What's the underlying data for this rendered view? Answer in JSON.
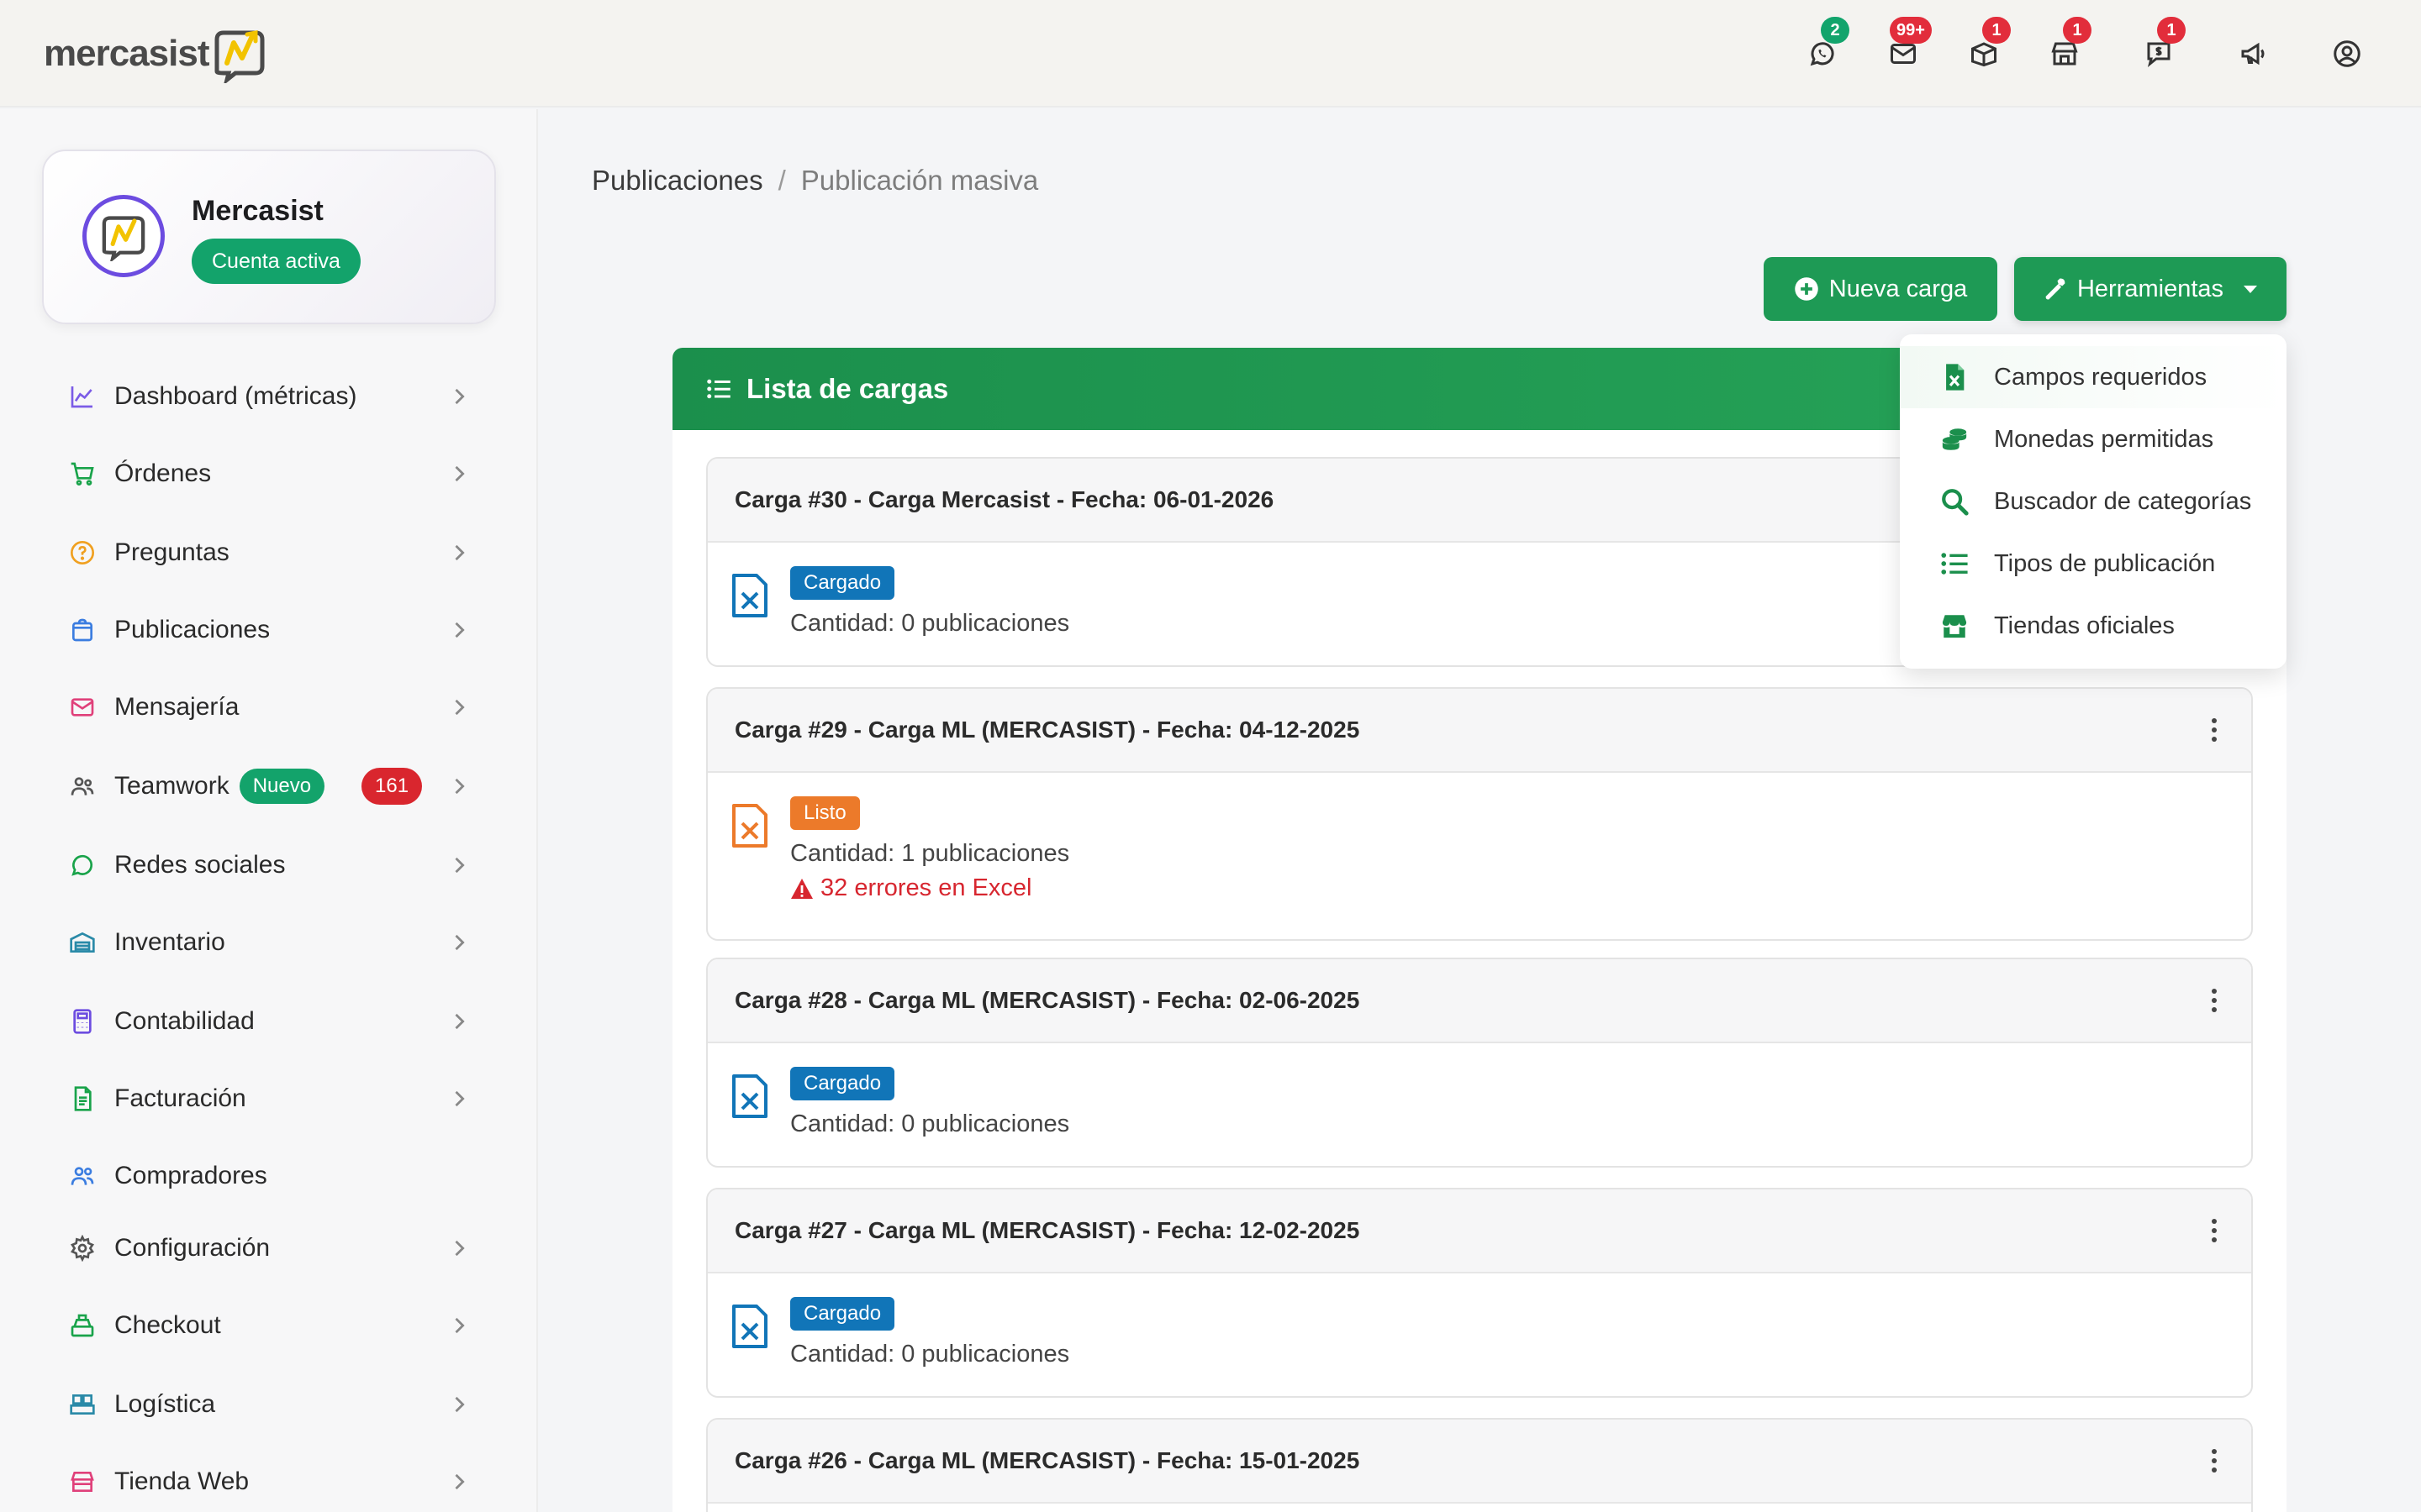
{
  "app": {
    "logo_text": "mercasist"
  },
  "top_icons": [
    {
      "icon": "whatsapp-icon",
      "badge": "2",
      "badge_color": "#12a46c"
    },
    {
      "icon": "mail-icon",
      "badge": "99+",
      "badge_color": "#e22d3b"
    },
    {
      "icon": "box-icon",
      "badge": "1",
      "badge_color": "#e22d3b"
    },
    {
      "icon": "store-icon",
      "badge": "1",
      "badge_color": "#e22d3b"
    },
    {
      "icon": "dollar-chat-icon",
      "badge": "1",
      "badge_color": "#e22d3b"
    },
    {
      "icon": "megaphone-icon",
      "badge": "",
      "badge_color": ""
    },
    {
      "icon": "user-circle-icon",
      "badge": "",
      "badge_color": ""
    }
  ],
  "account": {
    "name": "Mercasist",
    "status": "Cuenta activa"
  },
  "sidebar": {
    "items": [
      {
        "label": "Dashboard (métricas)",
        "icon": "chart-line-icon"
      },
      {
        "label": "Órdenes",
        "icon": "cart-icon"
      },
      {
        "label": "Preguntas",
        "icon": "question-icon"
      },
      {
        "label": "Publicaciones",
        "icon": "bag-icon"
      },
      {
        "label": "Mensajería",
        "icon": "envelope-icon"
      },
      {
        "label": "Teamwork",
        "icon": "users-icon",
        "new_badge": "Nuevo",
        "count": "161"
      },
      {
        "label": "Redes sociales",
        "icon": "whatsapp-icon"
      },
      {
        "label": "Inventario",
        "icon": "warehouse-icon"
      },
      {
        "label": "Contabilidad",
        "icon": "calculator-icon"
      },
      {
        "label": "Facturación",
        "icon": "invoice-icon"
      },
      {
        "label": "Compradores",
        "icon": "buyers-icon"
      },
      {
        "label": "Configuración",
        "icon": "gear-icon"
      },
      {
        "label": "Checkout",
        "icon": "register-icon"
      },
      {
        "label": "Logística",
        "icon": "truck-icon"
      },
      {
        "label": "Tienda Web",
        "icon": "storefront-icon"
      }
    ]
  },
  "breadcrumb": {
    "parent": "Publicaciones",
    "separator": "/",
    "current": "Publicación masiva"
  },
  "toolbar": {
    "new_label": "Nueva carga",
    "tools_label": "Herramientas"
  },
  "tools_menu": {
    "items": [
      {
        "label": "Campos requeridos",
        "icon": "excel-file-icon"
      },
      {
        "label": "Monedas permitidas",
        "icon": "coins-icon"
      },
      {
        "label": "Buscador de categorías",
        "icon": "search-icon"
      },
      {
        "label": "Tipos de publicación",
        "icon": "list-icon"
      },
      {
        "label": "Tiendas oficiales",
        "icon": "store-icon"
      }
    ]
  },
  "list": {
    "title": "Lista de cargas",
    "cards": [
      {
        "title": "Carga #30 - Carga Mercasist - Fecha: 06-01-2026",
        "status": "Cargado",
        "status_color": "#1175b8",
        "quantity": "Cantidad: 0 publicaciones",
        "error": ""
      },
      {
        "title": "Carga #29 - Carga ML (MERCASIST) - Fecha: 04-12-2025",
        "status": "Listo",
        "status_color": "#ec7a2a",
        "quantity": "Cantidad: 1 publicaciones",
        "error": "32 errores en Excel"
      },
      {
        "title": "Carga #28 - Carga ML (MERCASIST) - Fecha: 02-06-2025",
        "status": "Cargado",
        "status_color": "#1175b8",
        "quantity": "Cantidad: 0 publicaciones",
        "error": ""
      },
      {
        "title": "Carga #27 - Carga ML (MERCASIST) - Fecha: 12-02-2025",
        "status": "Cargado",
        "status_color": "#1175b8",
        "quantity": "Cantidad: 0 publicaciones",
        "error": ""
      },
      {
        "title": "Carga #26 - Carga ML (MERCASIST) - Fecha: 15-01-2025",
        "status": "",
        "status_color": "",
        "quantity": "",
        "error": ""
      }
    ]
  },
  "colors": {
    "primary_green": "#1e9a55",
    "badge_red": "#e22d3b",
    "status_blue": "#1175b8",
    "status_orange": "#ec7a2a",
    "error_red": "#d7262f"
  }
}
